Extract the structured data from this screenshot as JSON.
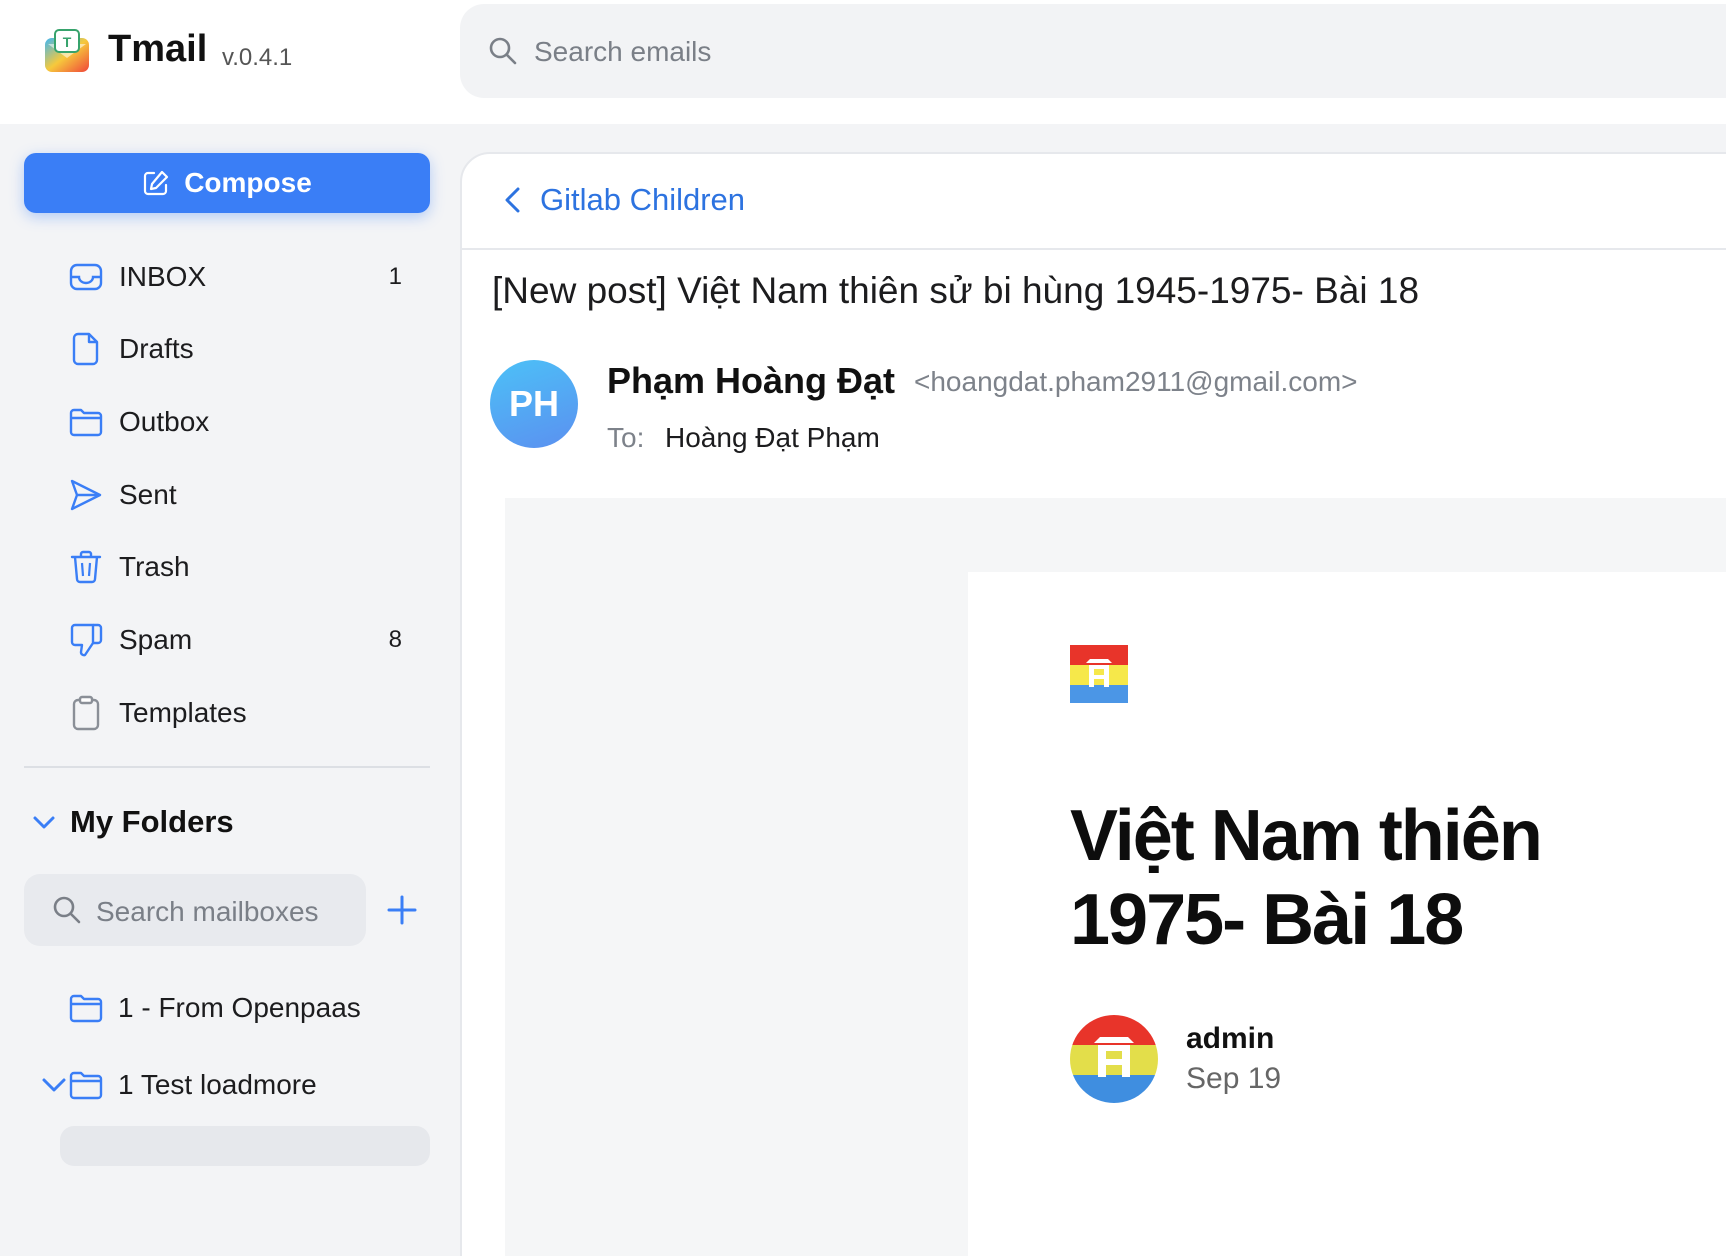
{
  "app": {
    "name": "Tmail",
    "version": "v.0.4.1",
    "search_placeholder": "Search emails"
  },
  "sidebar": {
    "compose_label": "Compose",
    "items": [
      {
        "label": "INBOX",
        "count": "1",
        "icon": "inbox-icon"
      },
      {
        "label": "Drafts",
        "count": "",
        "icon": "draft-icon"
      },
      {
        "label": "Outbox",
        "count": "",
        "icon": "folder-icon"
      },
      {
        "label": "Sent",
        "count": "",
        "icon": "send-icon"
      },
      {
        "label": "Trash",
        "count": "",
        "icon": "trash-icon"
      },
      {
        "label": "Spam",
        "count": "8",
        "icon": "thumbs-down-icon"
      },
      {
        "label": "Templates",
        "count": "",
        "icon": "clipboard-icon"
      }
    ],
    "my_folders": {
      "title": "My Folders",
      "search_placeholder": "Search mailboxes",
      "folders": [
        {
          "label": "1 - From Openpaas",
          "expanded": false
        },
        {
          "label": "1 Test loadmore",
          "expanded": true
        }
      ]
    }
  },
  "email": {
    "back_label": "Gitlab Children",
    "subject": "[New post] Việt Nam thiên sử bi hùng 1945-1975- Bài 18",
    "sender": {
      "initials": "PH",
      "name": "Phạm Hoàng Đạt",
      "email": "<hoangdat.pham2911@gmail.com>"
    },
    "to_label": "To:",
    "to_value": "Hoàng Đạt Phạm",
    "body": {
      "post_title": "Việt Nam thiên\n1975- Bài 18",
      "author": "admin",
      "date": "Sep 19"
    }
  },
  "colors": {
    "accent": "#3a7ef6",
    "link": "#2d73e0",
    "sidebar_bg": "#f3f4f6"
  }
}
